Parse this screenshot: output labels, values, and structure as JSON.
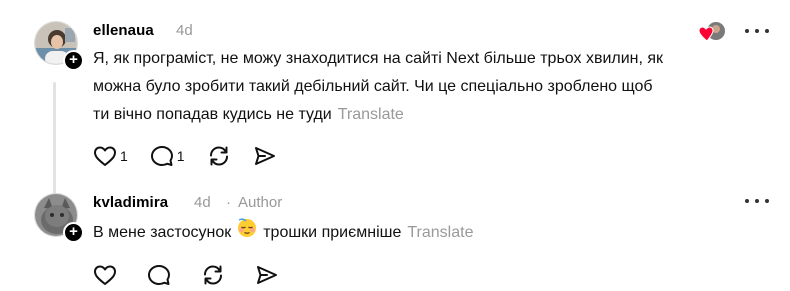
{
  "posts": [
    {
      "username": "ellenaua",
      "time": "4d",
      "text": "Я, як програміст, не можу знаходитися на сайті Next більше трьох хвилин, як можна було зробити такий дебільний сайт. Чи це спеціально зроблено щоб ти вічно попадав кудись не туди",
      "line1": "Я, як програміст, не можу знаходитися на сайті Next більше трьох хвилин, як",
      "line2": "можна було зробити такий дебільний сайт. Чи це спеціально зроблено щоб",
      "line3": "ти вічно попадав кудись не туди",
      "translate": "Translate",
      "likes": "1",
      "replies": "1"
    },
    {
      "username": "kvladimira",
      "time": "4d",
      "separator": "·",
      "role": "Author",
      "text_before": "В мене застосунок",
      "text_after": "трошки приємніше",
      "emoji": "relieved-face-emoji",
      "translate": "Translate"
    }
  ],
  "icons": {
    "like": "heart-icon",
    "reply": "comment-icon",
    "repost": "repost-icon",
    "share": "send-icon",
    "more": "more-dots-icon",
    "follow": "plus-icon",
    "liked_by_author": "heart-avatar-icon"
  },
  "colors": {
    "muted": "#999999",
    "heart": "#ff0034",
    "thread_line": "#e3e3e3"
  }
}
